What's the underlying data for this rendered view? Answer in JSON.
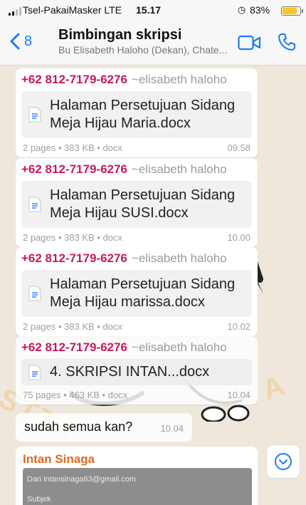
{
  "status_bar": {
    "carrier": "Tsel-PakaiMasker  LTE",
    "time": "15.17",
    "battery_percent": "83%",
    "battery_level": 0.83,
    "battery_color": "#f6c81f"
  },
  "header": {
    "back_count": "8",
    "title": "Bimbingan skripsi",
    "subtitle": "Bu Elisabeth Haloho (Dekan), Chate...",
    "accent_color": "#1a7cf5",
    "icons": [
      "back-chevron-icon",
      "video-call-icon",
      "phone-call-icon"
    ]
  },
  "watermark": {
    "left_text": "STTA",
    "right_text": "A"
  },
  "messages": [
    {
      "sender_number": "+62 812-7179-6276",
      "sender_alias": "~elisabeth haloho",
      "file_name": "Halaman Persetujuan Sidang Meja Hijau Maria.docx",
      "meta": "2 pages • 383 KB • docx",
      "time": "09.58"
    },
    {
      "sender_number": "+62 812-7179-6276",
      "sender_alias": "~elisabeth haloho",
      "file_name": "Halaman Persetujuan Sidang Meja Hijau SUSI.docx",
      "meta": "2 pages • 383 KB • docx",
      "time": "10.00"
    },
    {
      "sender_number": "+62 812-7179-6276",
      "sender_alias": "~elisabeth haloho",
      "file_name": "Halaman Persetujuan Sidang Meja Hijau marissa.docx",
      "meta": "2 pages • 383 KB • docx",
      "time": "10.02"
    },
    {
      "sender_number": "+62 812-7179-6276",
      "sender_alias": "~elisabeth haloho",
      "file_name": "4. SKRIPSI INTAN...docx",
      "meta": "75 pages • 463 KB • docx",
      "time": "10.04"
    }
  ],
  "text_message": {
    "text": "sudah semua kan?",
    "time": "10.04"
  },
  "email_message": {
    "sender": "Intan Sinaga",
    "sender_color": "#e06a1e",
    "from_line": "Dari  intansinaga63@gmail.com",
    "subject_line": "Subjek"
  },
  "sender_number_color": "#c8185e"
}
